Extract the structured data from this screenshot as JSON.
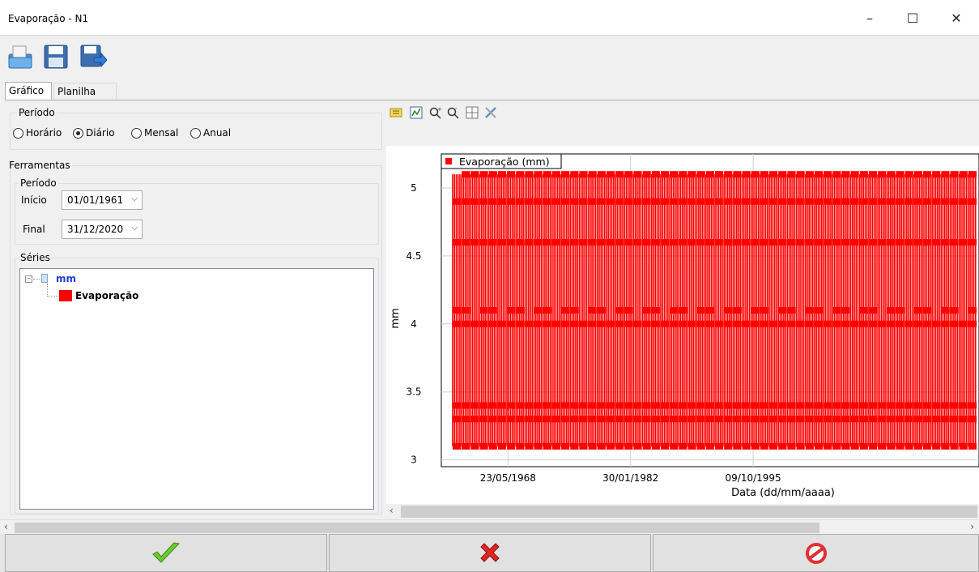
{
  "window": {
    "title": "Evaporação - N1",
    "controls": [
      "–",
      "☐",
      "✕"
    ]
  },
  "toolbar": {
    "icons": [
      "open-file-icon",
      "save-icon",
      "export-icon"
    ]
  },
  "tabs": [
    {
      "label": "Gráfico",
      "active": true
    },
    {
      "label": "Planilha",
      "active": false
    }
  ],
  "periodo_group": {
    "legend": "Período",
    "options": [
      {
        "label": "Horário",
        "selected": false
      },
      {
        "label": "Diário",
        "selected": true
      },
      {
        "label": "Mensal",
        "selected": false
      },
      {
        "label": "Anual",
        "selected": false
      }
    ]
  },
  "ferramentas": {
    "legend": "Ferramentas",
    "periodo": {
      "legend": "Período",
      "inicio_label": "Início",
      "inicio_value": "01/01/1961",
      "final_label": "Final",
      "final_value": "31/12/2020"
    },
    "series": {
      "legend": "Séries",
      "root": "mm",
      "items": [
        {
          "label": "Evaporação",
          "color": "#ff0000"
        }
      ]
    }
  },
  "chart_toolbar": {
    "icons": [
      "legend-icon",
      "chart-edit-icon",
      "zoom-in-icon",
      "zoom-out-icon",
      "grid-icon",
      "tools-icon"
    ]
  },
  "chart_data": {
    "type": "line",
    "title": "",
    "xlabel": "Data (dd/mm/aaaa)",
    "ylabel": "mm",
    "x_ticks": [
      "23/05/1968",
      "30/01/1982",
      "09/10/1995"
    ],
    "y_ticks": [
      "3",
      "3.5",
      "4",
      "4.5",
      "5"
    ],
    "ylim": [
      2.95,
      5.25
    ],
    "xlim": [
      "01/01/1961",
      "31/12/2020"
    ],
    "grid": true,
    "legend_position": "top-left",
    "series": [
      {
        "name": "Evaporação (mm)",
        "color": "#ff0000",
        "marker": "square",
        "value_levels": [
          3.1,
          3.3,
          3.4,
          4.0,
          4.1,
          4.6,
          4.9,
          5.1
        ],
        "note_levels": "daily values oscillate between these levels throughout the period"
      }
    ]
  },
  "bottom_buttons": [
    {
      "name": "confirm-button",
      "icon": "check-icon",
      "color": "#5fbf2f"
    },
    {
      "name": "cancel-button",
      "icon": "x-icon",
      "color": "#e02020"
    },
    {
      "name": "close-button",
      "icon": "forbidden-icon",
      "color": "#e03030"
    }
  ]
}
